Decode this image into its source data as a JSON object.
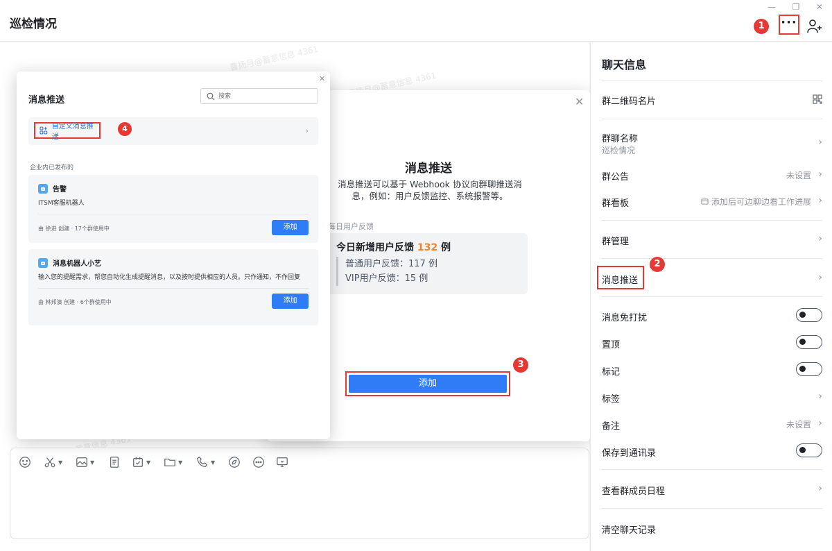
{
  "window": {
    "title": "巡检情况",
    "min_glyph": "—",
    "restore_glyph": "❐",
    "close_glyph": "✕",
    "more_glyph": "···"
  },
  "badges": [
    "1",
    "2",
    "3",
    "4"
  ],
  "colors": {
    "accent": "#2f7cf6",
    "annotation": "#e53935",
    "highlight_number": "#f5822a"
  },
  "watermark": "曹扬月@蓄意信息 4361",
  "composer": {
    "tools": [
      {
        "icon": "emoji-icon",
        "caret": false
      },
      {
        "icon": "scissors-icon",
        "caret": true
      },
      {
        "icon": "image-icon",
        "caret": true
      },
      {
        "icon": "document-icon",
        "caret": false
      },
      {
        "icon": "task-icon",
        "caret": true
      },
      {
        "icon": "folder-icon",
        "caret": true
      },
      {
        "icon": "phone-icon",
        "caret": true
      },
      {
        "icon": "rocket-icon",
        "caret": false
      },
      {
        "icon": "more-circle-icon",
        "caret": false
      },
      {
        "icon": "screen-icon",
        "caret": false
      }
    ]
  },
  "back_modal": {
    "title": "消息推送",
    "description": "消息推送可以基于 Webhook 协议向群聊推送消息，例如：用户反馈监控、系统报警等。",
    "feedback_label": "每日用户反馈",
    "feedback_title_prefix": "今日新增用户反馈 ",
    "feedback_count": "132",
    "feedback_title_suffix": " 例",
    "feedback_lines": [
      "普通用户反馈：117 例",
      "VIP用户反馈：15 例"
    ],
    "add_label": "添加"
  },
  "front_modal": {
    "title": "消息推送",
    "search_placeholder": "搜索",
    "custom_push_label": "自定义消息推送",
    "section_label": "企业内已发布的",
    "bots": [
      {
        "name": "告警",
        "description": "ITSM客服机器人",
        "meta": "由 徐进 创建 · 17个群使用中",
        "add_label": "添加"
      },
      {
        "name": "消息机器人小艺",
        "description": "输入您的提醒需求，帮您自动化生成提醒消息，以及按时提供相应的人员。只作通知，不作回复",
        "meta": "由 林邦演 创建 · 6个群使用中",
        "add_label": "添加"
      }
    ]
  },
  "side": {
    "title": "聊天信息",
    "qr_label": "群二维码名片",
    "group_name_label": "群聊名称",
    "group_name_value": "巡检情况",
    "announcement_label": "群公告",
    "announcement_value": "未设置",
    "board_label": "群看板",
    "board_value": "添加后可边聊边看工作进展",
    "manage_label": "群管理",
    "push_label": "消息推送",
    "mute_label": "消息免打扰",
    "pin_label": "置顶",
    "mark_label": "标记",
    "tags_label": "标签",
    "remark_label": "备注",
    "remark_value": "未设置",
    "save_contacts_label": "保存到通讯录",
    "schedule_label": "查看群成员日程",
    "clear_label": "清空聊天记录"
  }
}
